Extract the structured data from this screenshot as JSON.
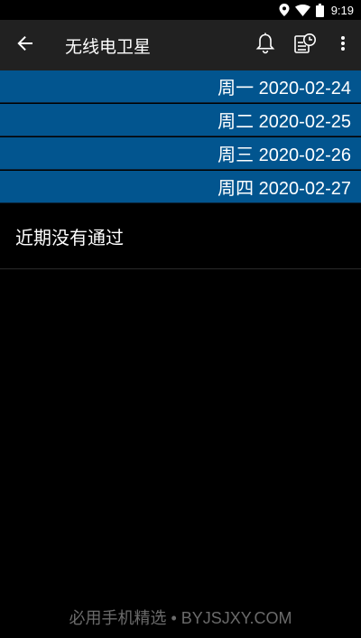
{
  "status_bar": {
    "time": "9:19",
    "icons": [
      "location-icon",
      "wifi-icon",
      "battery-icon"
    ]
  },
  "toolbar": {
    "title": "无线电卫星",
    "icons": [
      "back-arrow-icon",
      "bell-icon",
      "schedule-icon",
      "more-vert-icon"
    ]
  },
  "dates": [
    {
      "label": "周一 2020-02-24"
    },
    {
      "label": "周二 2020-02-25"
    },
    {
      "label": "周三 2020-02-26"
    },
    {
      "label": "周四 2020-02-27"
    }
  ],
  "empty_message": "近期没有通过",
  "watermark": "必用手机精选 • BYJSJXY.COM",
  "colors": {
    "toolbar_bg": "#212121",
    "date_row_bg": "#02558f",
    "page_bg": "#000000"
  }
}
